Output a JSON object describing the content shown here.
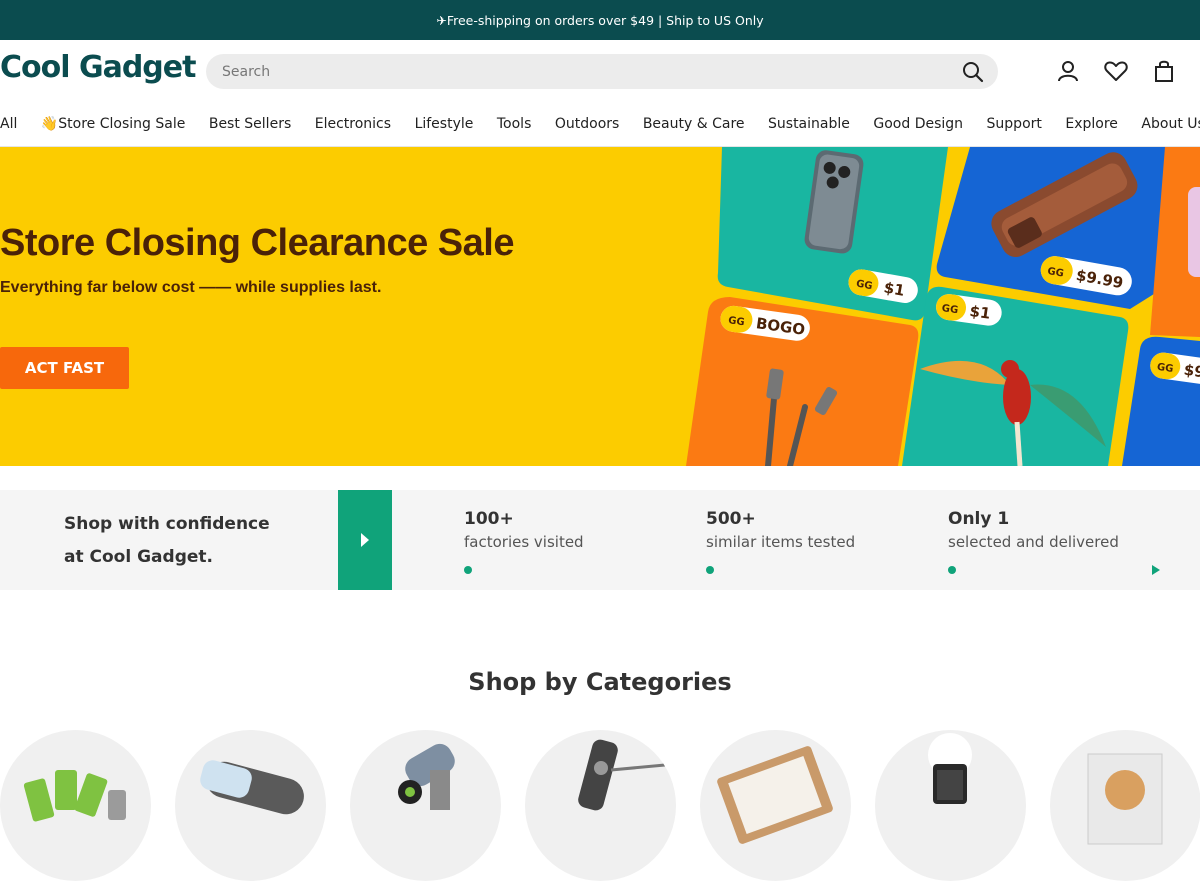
{
  "announcement": "✈Free-shipping on orders over $49 | Ship to US Only",
  "header": {
    "logo": "Cool Gadget",
    "search_placeholder": "Search"
  },
  "nav": [
    "All",
    "👋Store Closing Sale",
    "Best Sellers",
    "Electronics",
    "Lifestyle",
    "Tools",
    "Outdoors",
    "Beauty & Care",
    "Sustainable",
    "Good Design",
    "Support",
    "Explore",
    "About Us"
  ],
  "hero": {
    "title": "Store Closing Clearance Sale",
    "subtitle": "Everything far below cost —— while supplies last.",
    "cta": "ACT FAST",
    "badges": [
      "$1",
      "$9.99",
      "BOGO",
      "$1",
      "$9"
    ],
    "colors": {
      "bg": "#fccc00",
      "cta": "#f7680c",
      "title": "#4a2208"
    }
  },
  "trust": {
    "lead_line1": "Shop with confidence",
    "lead_line2": "at Cool Gadget.",
    "stats": [
      {
        "num": "100+",
        "label": "factories visited"
      },
      {
        "num": "500+",
        "label": "similar items tested"
      },
      {
        "num": "Only 1",
        "label": "selected and delivered"
      }
    ]
  },
  "categories_title": "Shop by Categories",
  "categories": [
    "usb-cables",
    "portable-vacuum",
    "massage-gun",
    "multitool",
    "sketch-board",
    "flashlight",
    "lamp"
  ]
}
